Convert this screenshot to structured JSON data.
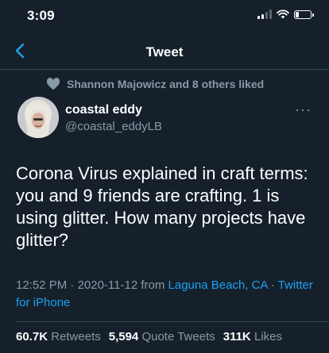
{
  "status_bar": {
    "time": "3:09"
  },
  "header": {
    "title": "Tweet"
  },
  "social_context": {
    "text": "Shannon Majowicz and 8 others liked"
  },
  "author": {
    "display_name": "coastal eddy",
    "handle": "@coastal_eddyLB"
  },
  "tweet": {
    "text": "Corona Virus explained in craft terms: you and 9 friends are crafting. 1 is using glitter. How many projects have glitter?"
  },
  "meta": {
    "time": "12:52 PM",
    "separator": " · ",
    "date": "2020-11-12",
    "from_label": " from ",
    "location": "Laguna Beach, CA",
    "separator2": " · ",
    "source": "Twitter for iPhone"
  },
  "stats": {
    "retweets_count": "60.7K",
    "retweets_label": "Retweets",
    "quotes_count": "5,594",
    "quotes_label": "Quote Tweets",
    "likes_count": "311K",
    "likes_label": "Likes"
  },
  "colors": {
    "background": "#15202b",
    "accent": "#1da1f2",
    "secondary_text": "#8899a6",
    "divider": "#38444d"
  }
}
